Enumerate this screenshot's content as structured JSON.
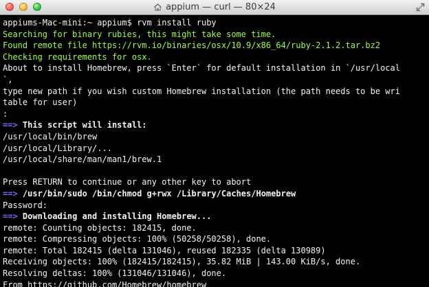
{
  "window": {
    "title": "appium — curl — 80×24",
    "colors": {
      "background": "#000000",
      "white_text": "#f4f4f4",
      "green_text": "#9ffd49",
      "blue_arrow": "#6e6bff",
      "titlebar": "#dddddd"
    },
    "icons": {
      "title_icon": "home-icon",
      "corner_icon": "fullscreen-icon"
    }
  },
  "terminal": {
    "lines": [
      {
        "text": "appiums-Mac-mini:~ appium$ rvm install ruby",
        "color": "white"
      },
      {
        "text": "Searching for binary rubies, this might take some time.",
        "color": "green"
      },
      {
        "text": "Found remote file https://rvm.io/binaries/osx/10.9/x86_64/ruby-2.1.2.tar.bz2",
        "color": "green"
      },
      {
        "text": "Checking requirements for osx.",
        "color": "green"
      },
      {
        "text": "About to install Homebrew, press `Enter` for default installation in `/usr/local",
        "color": "white"
      },
      {
        "text": "`,",
        "color": "white"
      },
      {
        "text": "type new path if you wish custom Homebrew installation (the path needs to be wri",
        "color": "white"
      },
      {
        "text": "table for user)",
        "color": "white"
      },
      {
        "text": ":",
        "color": "white"
      },
      {
        "prefix": "==>",
        "text": " This script will install:",
        "color": "white",
        "bold": true
      },
      {
        "text": "/usr/local/bin/brew",
        "color": "white"
      },
      {
        "text": "/usr/local/Library/...",
        "color": "white"
      },
      {
        "text": "/usr/local/share/man/man1/brew.1",
        "color": "white"
      },
      {
        "text": "",
        "color": "white"
      },
      {
        "text": "Press RETURN to continue or any other key to abort",
        "color": "white"
      },
      {
        "prefix": "==>",
        "text": " /usr/bin/sudo /bin/chmod g+rwx /Library/Caches/Homebrew",
        "color": "white",
        "bold": true
      },
      {
        "text": "Password:",
        "color": "white"
      },
      {
        "prefix": "==>",
        "text": " Downloading and installing Homebrew...",
        "color": "white",
        "bold": true
      },
      {
        "text": "remote: Counting objects: 182415, done.",
        "color": "white"
      },
      {
        "text": "remote: Compressing objects: 100% (50258/50258), done.",
        "color": "white"
      },
      {
        "text": "remote: Total 182415 (delta 131046), reused 182335 (delta 130989)",
        "color": "white"
      },
      {
        "text": "Receiving objects: 100% (182415/182415), 35.82 MiB | 143.00 KiB/s, done.",
        "color": "white"
      },
      {
        "text": "Resolving deltas: 100% (131046/131046), done.",
        "color": "white"
      },
      {
        "text": "From https://github.com/Homebrew/homebrew",
        "color": "white"
      }
    ]
  }
}
